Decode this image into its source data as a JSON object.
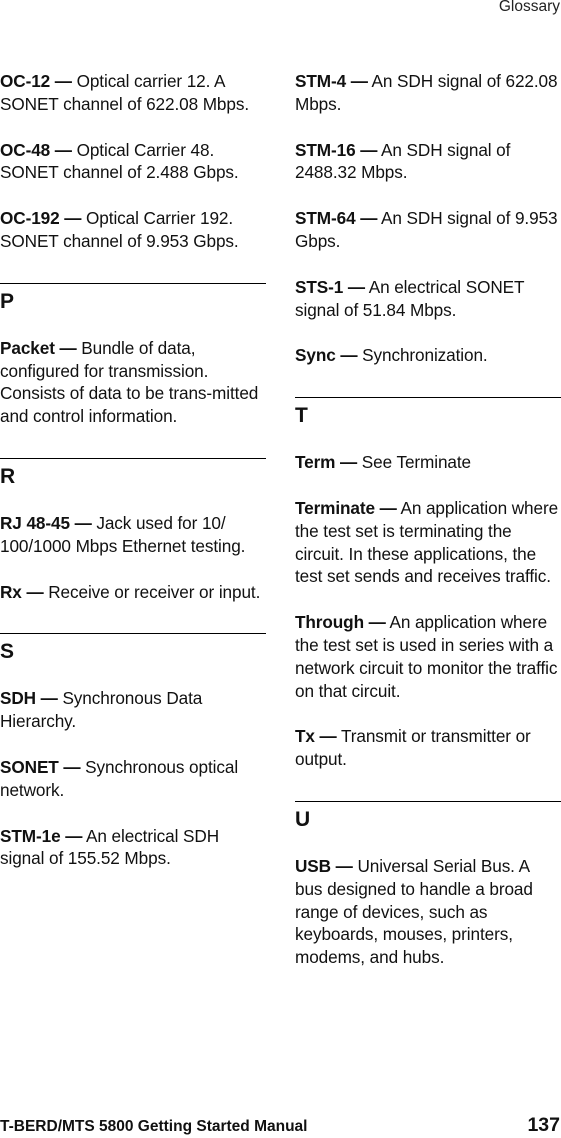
{
  "header": {
    "running_head": "Glossary"
  },
  "left_column": {
    "pre_entries": [
      {
        "term": "OC-12 —",
        "definition": " Optical carrier 12. A SONET channel of 622.08 Mbps."
      },
      {
        "term": "OC-48 —",
        "definition": " Optical Carrier 48. SONET channel of 2.488 Gbps."
      },
      {
        "term": "OC-192 —",
        "definition": " Optical Carrier 192. SONET channel of 9.953 Gbps."
      }
    ],
    "sections": [
      {
        "letter": "P",
        "entries": [
          {
            "term": "Packet —",
            "definition": " Bundle of data, configured for transmission. Consists of data to be trans-mitted and control information."
          }
        ]
      },
      {
        "letter": "R",
        "entries": [
          {
            "term": "RJ 48-45 —",
            "definition": " Jack used for 10/ 100/1000 Mbps Ethernet testing."
          },
          {
            "term": "Rx —",
            "definition": " Receive or receiver or input."
          }
        ]
      },
      {
        "letter": "S",
        "entries": [
          {
            "term": "SDH —",
            "definition": " Synchronous Data Hierarchy."
          },
          {
            "term": "SONET —",
            "definition": " Synchronous optical network."
          },
          {
            "term": "STM-1e —",
            "definition": " An electrical SDH signal of 155.52 Mbps."
          }
        ]
      }
    ]
  },
  "right_column": {
    "pre_entries": [
      {
        "term": "STM-4 —",
        "definition": " An SDH signal of 622.08 Mbps."
      },
      {
        "term": "STM-16 —",
        "definition": " An SDH signal of 2488.32 Mbps."
      },
      {
        "term": "STM-64 —",
        "definition": " An SDH signal of 9.953 Gbps."
      },
      {
        "term": "STS-1 —",
        "definition": " An electrical SONET signal of 51.84 Mbps."
      },
      {
        "term": "Sync —",
        "definition": " Synchronization."
      }
    ],
    "sections": [
      {
        "letter": "T",
        "entries": [
          {
            "term": "Term —",
            "definition": " See Terminate"
          },
          {
            "term": "Terminate —",
            "definition": " An application where the test set is terminating the circuit. In these applications, the test set sends and receives traffic."
          },
          {
            "term": "Through —",
            "definition": " An application where the test set is used in series with a network circuit to monitor the traffic on that circuit."
          },
          {
            "term": "Tx —",
            "definition": " Transmit or transmitter or output."
          }
        ]
      },
      {
        "letter": "U",
        "entries": [
          {
            "term": "USB —",
            "definition": " Universal Serial Bus. A bus designed to handle a broad range of devices, such as keyboards, mouses, printers, modems, and hubs."
          }
        ]
      }
    ]
  },
  "footer": {
    "manual_title": "T-BERD/MTS 5800 Getting Started Manual",
    "page_number": "137"
  }
}
